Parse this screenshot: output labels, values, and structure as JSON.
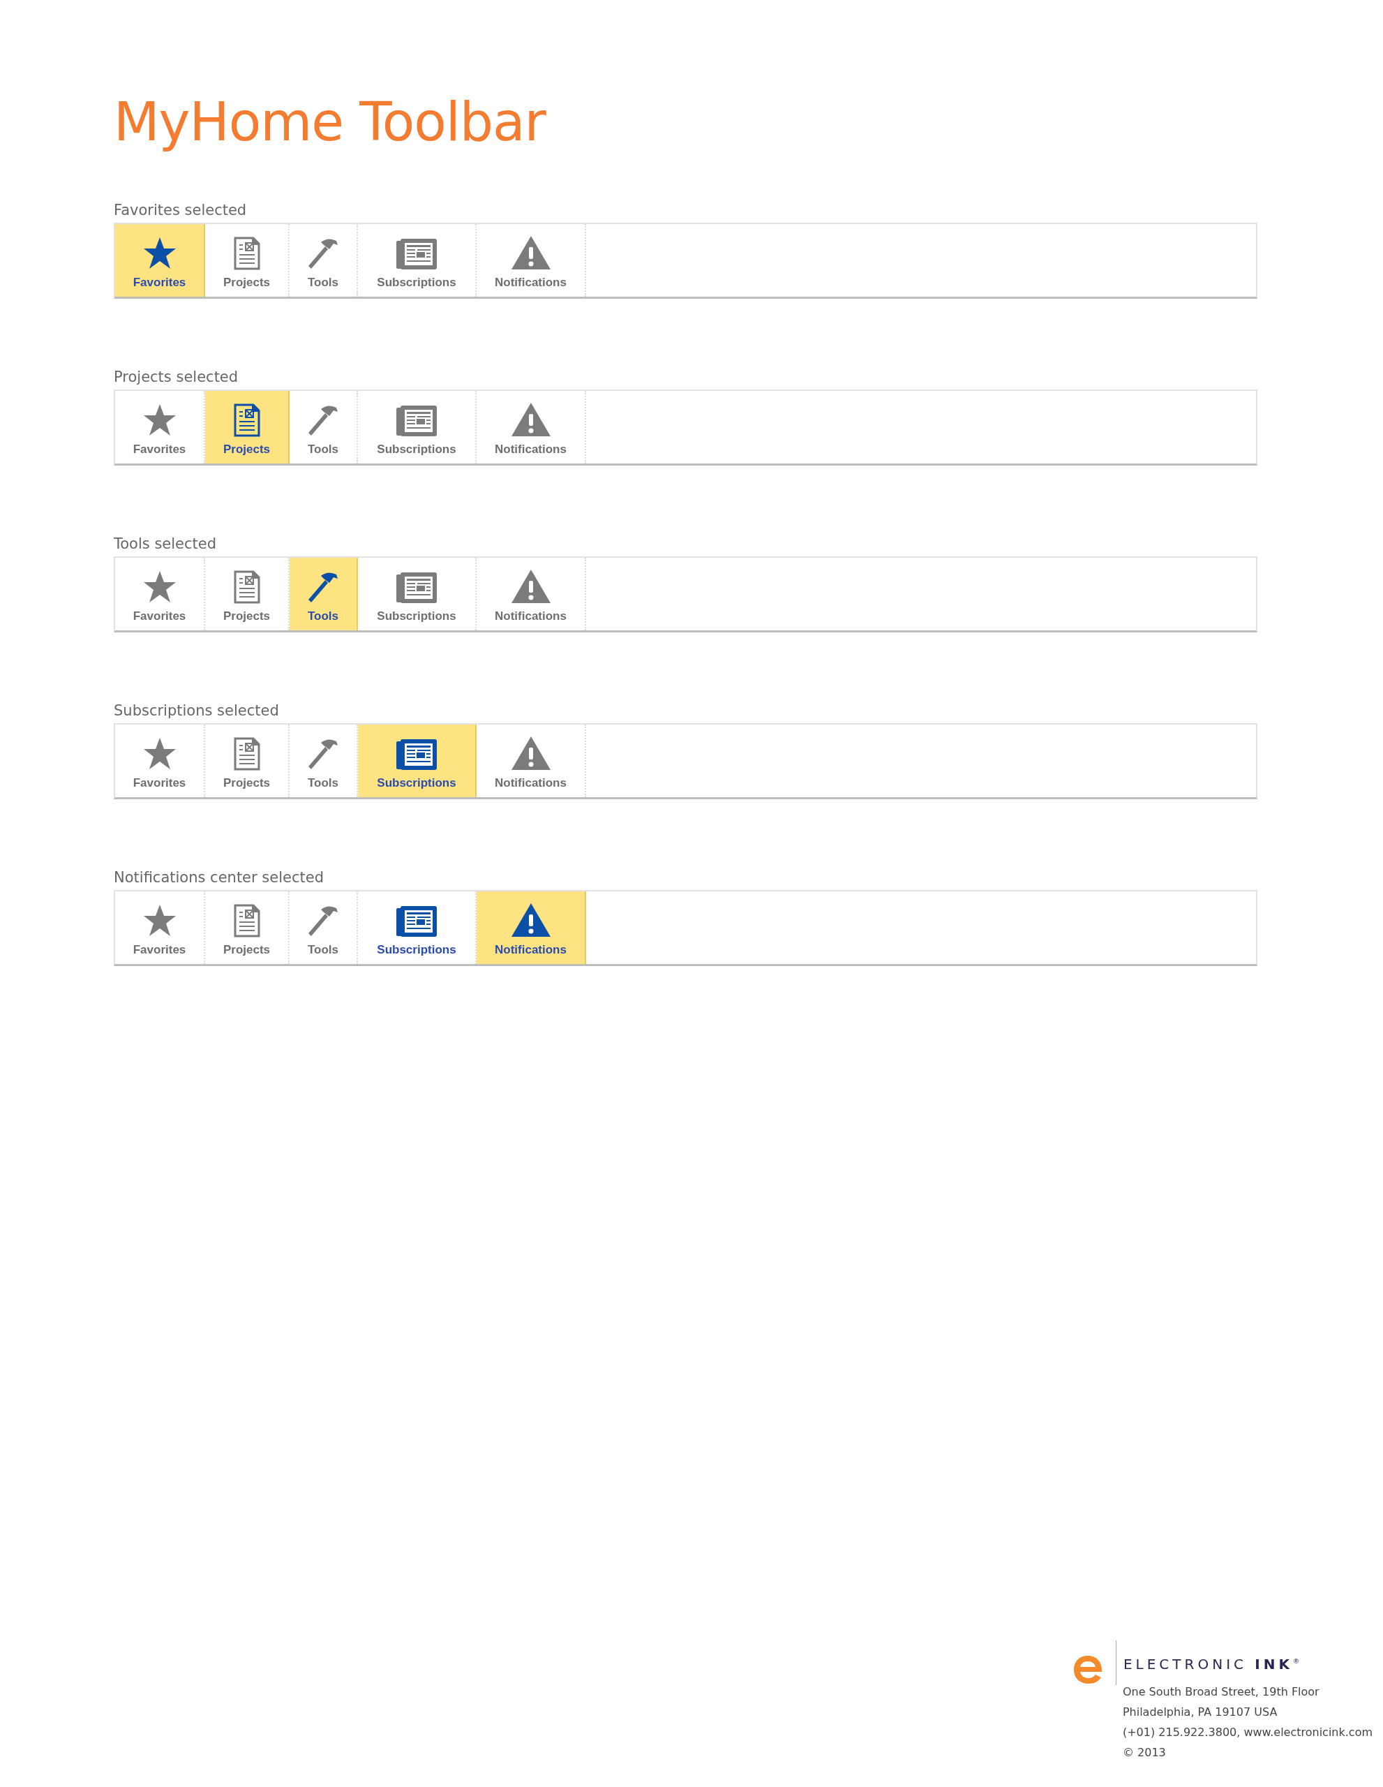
{
  "title": "MyHome Toolbar",
  "sections": [
    {
      "label": "Favorites selected",
      "items": [
        {
          "kind": "star",
          "label": "Favorites",
          "selected": true,
          "active": true
        },
        {
          "kind": "document",
          "label": "Projects",
          "selected": false,
          "active": false
        },
        {
          "kind": "hammer",
          "label": "Tools",
          "selected": false,
          "active": false
        },
        {
          "kind": "newspaper",
          "label": "Subscriptions",
          "selected": false,
          "active": false
        },
        {
          "kind": "warning",
          "label": "Notifications",
          "selected": false,
          "active": false
        }
      ]
    },
    {
      "label": "Projects selected",
      "items": [
        {
          "kind": "star",
          "label": "Favorites",
          "selected": false,
          "active": false
        },
        {
          "kind": "document",
          "label": "Projects",
          "selected": true,
          "active": true
        },
        {
          "kind": "hammer",
          "label": "Tools",
          "selected": false,
          "active": false
        },
        {
          "kind": "newspaper",
          "label": "Subscriptions",
          "selected": false,
          "active": false
        },
        {
          "kind": "warning",
          "label": "Notifications",
          "selected": false,
          "active": false
        }
      ]
    },
    {
      "label": "Tools selected",
      "items": [
        {
          "kind": "star",
          "label": "Favorites",
          "selected": false,
          "active": false
        },
        {
          "kind": "document",
          "label": "Projects",
          "selected": false,
          "active": false
        },
        {
          "kind": "hammer",
          "label": "Tools",
          "selected": true,
          "active": true
        },
        {
          "kind": "newspaper",
          "label": "Subscriptions",
          "selected": false,
          "active": false
        },
        {
          "kind": "warning",
          "label": "Notifications",
          "selected": false,
          "active": false
        }
      ]
    },
    {
      "label": "Subscriptions selected",
      "items": [
        {
          "kind": "star",
          "label": "Favorites",
          "selected": false,
          "active": false
        },
        {
          "kind": "document",
          "label": "Projects",
          "selected": false,
          "active": false
        },
        {
          "kind": "hammer",
          "label": "Tools",
          "selected": false,
          "active": false
        },
        {
          "kind": "newspaper",
          "label": "Subscriptions",
          "selected": true,
          "active": true
        },
        {
          "kind": "warning",
          "label": "Notifications",
          "selected": false,
          "active": false
        }
      ]
    },
    {
      "label": "Notifications center selected",
      "items": [
        {
          "kind": "star",
          "label": "Favorites",
          "selected": false,
          "active": false
        },
        {
          "kind": "document",
          "label": "Projects",
          "selected": false,
          "active": false
        },
        {
          "kind": "hammer",
          "label": "Tools",
          "selected": false,
          "active": false
        },
        {
          "kind": "newspaper",
          "label": "Subscriptions",
          "selected": false,
          "active": true
        },
        {
          "kind": "warning",
          "label": "Notifications",
          "selected": true,
          "active": true
        }
      ]
    }
  ],
  "footer": {
    "brand": "ELECTRONIC **INK**$^{®}$",
    "lines": [
      "One South Broad Street, 19th Floor",
      "Philadelphia, PA 19107 USA",
      "(+01) 215.922.3800, www.electronicink.com",
      "© 2013"
    ]
  }
}
